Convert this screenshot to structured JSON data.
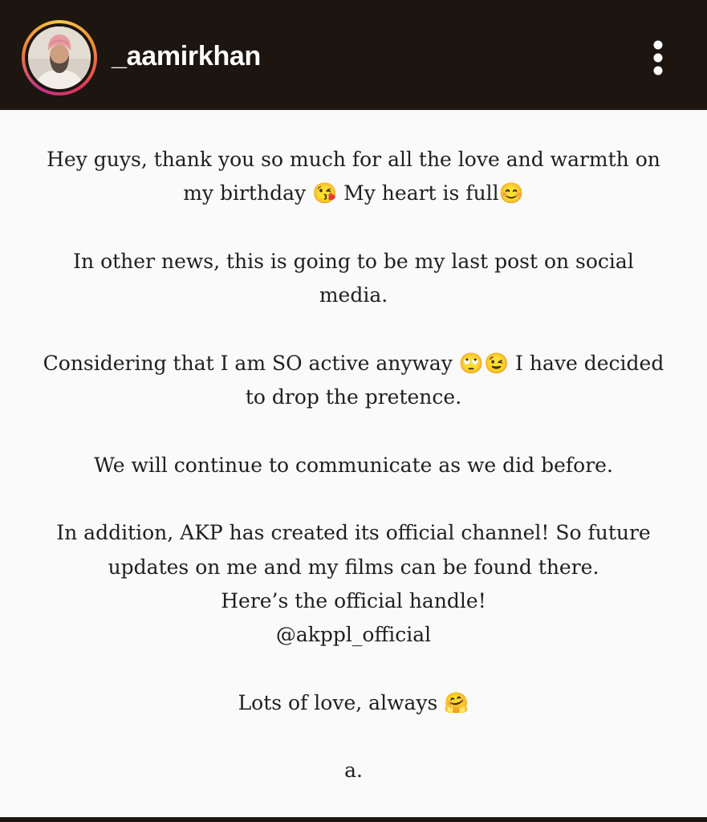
{
  "header": {
    "username": "_aamirkhan",
    "avatar_icon": "profile-photo",
    "more_icon": "more-vertical-icon",
    "background_color": "#1c1510"
  },
  "post": {
    "paragraphs": [
      "Hey guys, thank you so much for all the love and warmth on\nmy birthday 😘 My heart is full😊",
      "In other news, this is going to be my last post on social\nmedia.",
      "Considering that I am SO active anyway 🙄😉 I have decided\nto drop the pretence.",
      "We will continue to communicate as we did before.",
      "In addition, AKP has created its official channel! So future\nupdates on me and my films can be found there.\nHere’s the official handle!\n@akppl_official",
      "Lots of love, always 🤗",
      "a."
    ]
  }
}
